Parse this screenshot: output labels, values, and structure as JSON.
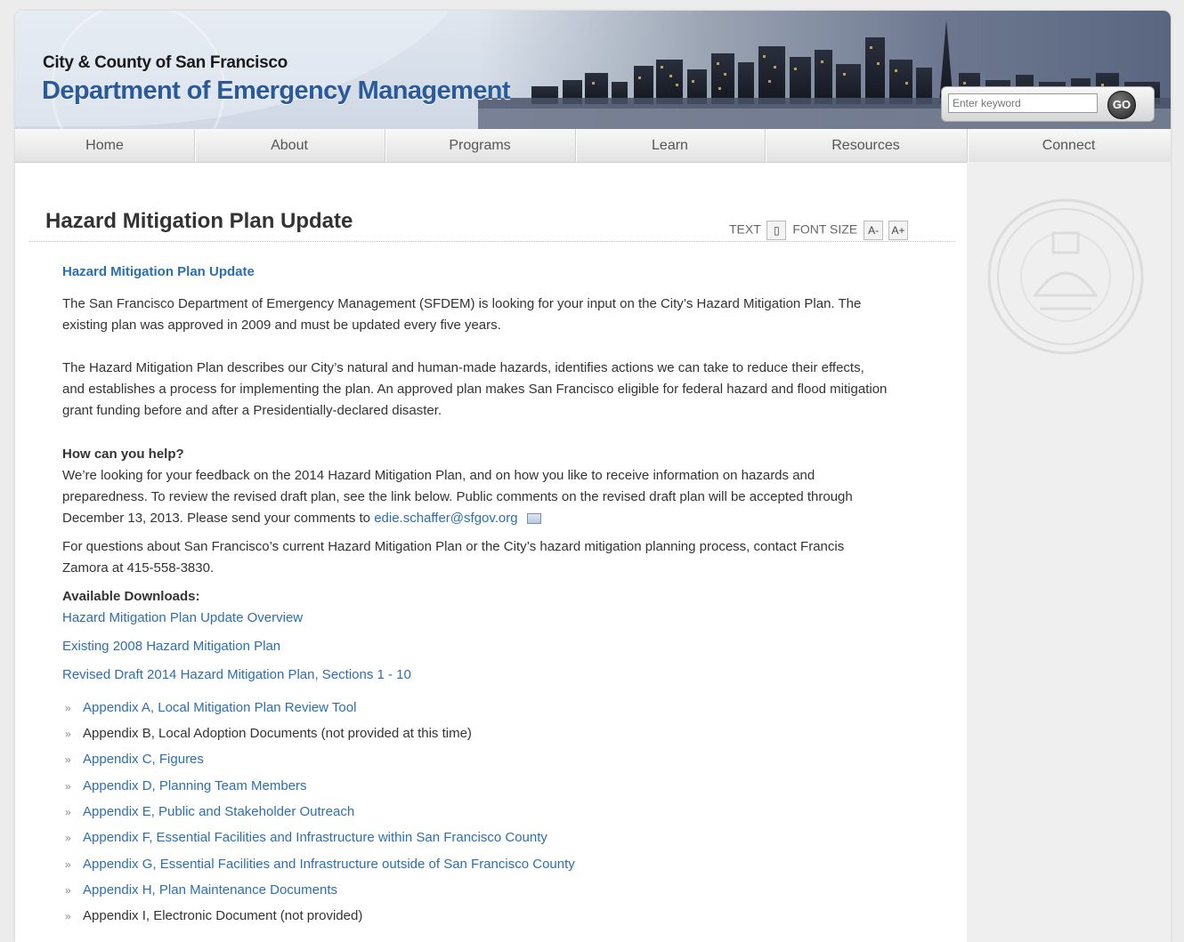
{
  "header": {
    "subtitle": "City & County of San Francisco",
    "title": "Department of Emergency Management",
    "search_placeholder": "Enter keyword",
    "search_button": "GO"
  },
  "nav": [
    "Home",
    "About",
    "Programs",
    "Learn",
    "Resources",
    "Connect"
  ],
  "page": {
    "title": "Hazard Mitigation Plan Update",
    "tools": {
      "text_label": "TEXT",
      "font_size_label": "FONT SIZE",
      "decrease": "A-",
      "increase": "A+"
    },
    "heading_link": "Hazard Mitigation Plan Update",
    "para1_line1": "The San Francisco Department of Emergency Management (SFDEM) is looking for your input on the City’s Hazard Mitigation Plan. The",
    "para1_line2": "existing plan was approved in 2009 and must be updated every five years.",
    "para2_line1": "The Hazard Mitigation Plan describes our City’s natural and human-made hazards, identifies actions we can take to reduce their effects,",
    "para2_line2": "and establishes a process for implementing the plan. An approved plan makes San Francisco eligible for federal hazard and flood mitigation",
    "para2_line3": "grant funding before and after a Presidentially-declared disaster.",
    "help_heading": "How can you help?",
    "help_line1": "We’re looking for your feedback on the 2014 Hazard Mitigation Plan, and on how you like to receive information on hazards and",
    "help_line2": "preparedness. To review the revised draft plan, see the link below.  Public comments on the revised draft plan will be accepted through",
    "help_line3_prefix": "December 13, 2013.  Please send your comments to ",
    "help_email": "edie.schaffer@sfgov.org",
    "questions_line1": "For questions about San Francisco’s current Hazard Mitigation Plan or the City’s hazard mitigation planning process, contact Francis",
    "questions_line2": "Zamora at 415-558-3830.",
    "downloads_heading": "Available Downloads:",
    "downloads": [
      "Hazard Mitigation Plan Update Overview",
      "Existing 2008 Hazard Mitigation Plan",
      "Revised Draft 2014 Hazard Mitigation Plan, Sections 1 - 10"
    ],
    "appendices": [
      {
        "label": "Appendix A, Local Mitigation Plan Review Tool",
        "link": true
      },
      {
        "label": "Appendix B, Local Adoption Documents (not provided at this time)",
        "link": false
      },
      {
        "label": "Appendix C, Figures",
        "link": true
      },
      {
        "label": "Appendix D, Planning Team Members",
        "link": true
      },
      {
        "label": "Appendix E, Public and Stakeholder Outreach",
        "link": true
      },
      {
        "label": "Appendix F, Essential Facilities and Infrastructure within San Francisco County",
        "link": true
      },
      {
        "label": "Appendix G, Essential Facilities and Infrastructure outside of San Francisco County",
        "link": true
      },
      {
        "label": "Appendix H, Plan Maintenance Documents",
        "link": true
      },
      {
        "label": "Appendix I, Electronic Document (not provided)",
        "link": false
      }
    ],
    "bullet_glyph": "»"
  },
  "colors": {
    "link": "#2c6fb0",
    "title_blue": "#2a5a99",
    "text": "#333333",
    "sidebar": "#efefef"
  }
}
